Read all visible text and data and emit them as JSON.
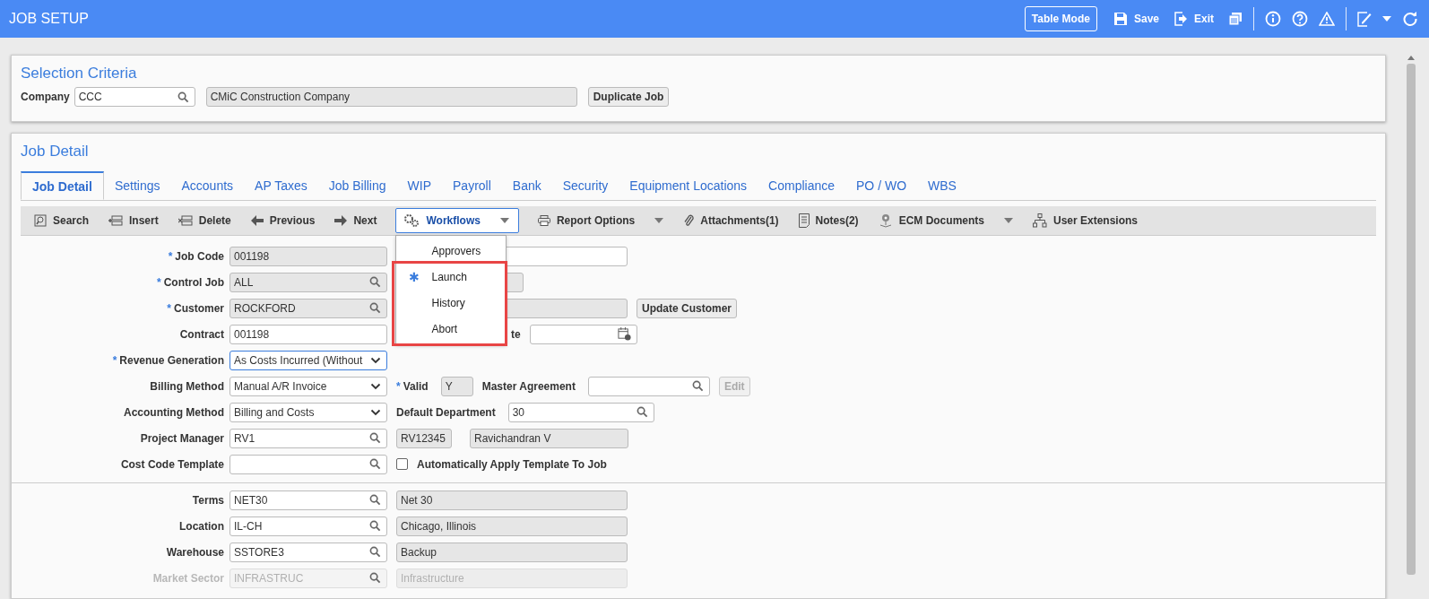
{
  "header": {
    "title": "JOB SETUP",
    "table_mode": "Table Mode",
    "save": "Save",
    "exit": "Exit"
  },
  "selection": {
    "title": "Selection Criteria",
    "company_label": "Company",
    "company": "CCC",
    "company_name": "CMiC Construction Company",
    "duplicate": "Duplicate Job"
  },
  "detail": {
    "title": "Job Detail",
    "tabs": [
      {
        "label": "Job Detail",
        "selected": true
      },
      {
        "label": "Settings",
        "selected": false
      },
      {
        "label": "Accounts",
        "selected": false
      },
      {
        "label": "AP Taxes",
        "selected": false
      },
      {
        "label": "Job Billing",
        "selected": false
      },
      {
        "label": "WIP",
        "selected": false
      },
      {
        "label": "Payroll",
        "selected": false
      },
      {
        "label": "Bank",
        "selected": false
      },
      {
        "label": "Security",
        "selected": false
      },
      {
        "label": "Equipment Locations",
        "selected": false
      },
      {
        "label": "Compliance",
        "selected": false
      },
      {
        "label": "PO / WO",
        "selected": false
      },
      {
        "label": "WBS",
        "selected": false
      }
    ],
    "toolbar": [
      {
        "label": "Search",
        "dropdown": false,
        "open": false
      },
      {
        "label": "Insert",
        "dropdown": false,
        "open": false
      },
      {
        "label": "Delete",
        "dropdown": false,
        "open": false
      },
      {
        "label": "Previous",
        "dropdown": false,
        "open": false
      },
      {
        "label": "Next",
        "dropdown": false,
        "open": false
      },
      {
        "label": "Workflows",
        "dropdown": true,
        "open": true
      },
      {
        "label": "Report Options",
        "dropdown": true,
        "open": false
      },
      {
        "label": "Attachments(1)",
        "dropdown": false,
        "open": false
      },
      {
        "label": "Notes(2)",
        "dropdown": false,
        "open": false
      },
      {
        "label": "ECM Documents",
        "dropdown": true,
        "open": false
      },
      {
        "label": "User Extensions",
        "dropdown": false,
        "open": false
      }
    ],
    "menu": [
      {
        "label": "Approvers"
      },
      {
        "label": "Launch",
        "icon": "✱"
      },
      {
        "label": "History"
      },
      {
        "label": "Abort"
      }
    ],
    "rows": [
      {
        "label": "Job Code",
        "mark": "*",
        "disabled": false,
        "field": {
          "kind": "text",
          "value": "001198",
          "readonly": true,
          "focused": false
        },
        "extras": [
          {
            "kind": "field",
            "readonly": false
          }
        ]
      },
      {
        "label": "Control Job",
        "mark": "*",
        "disabled": false,
        "field": {
          "kind": "lookup",
          "value": "ALL",
          "readonly": true,
          "focused": false
        },
        "extras": [
          {
            "kind": "field",
            "readonly": true
          }
        ]
      },
      {
        "label": "Customer",
        "mark": "*",
        "disabled": false,
        "field": {
          "kind": "lookup",
          "value": "ROCKFORD",
          "readonly": true,
          "focused": false
        },
        "extras": [
          {
            "kind": "field",
            "readonly": true
          },
          {
            "kind": "button",
            "label": "Update Customer",
            "disabled": false
          }
        ]
      },
      {
        "label": "Contract",
        "disabled": false,
        "field": {
          "kind": "text",
          "value": "001198",
          "readonly": false,
          "focused": false
        },
        "extras": [
          {
            "kind": "label",
            "label": "te"
          },
          {
            "kind": "date"
          }
        ]
      },
      {
        "label": "Revenue Generation",
        "mark": "*",
        "disabled": false,
        "field": {
          "kind": "select",
          "value": "As Costs Incurred (Without",
          "readonly": false,
          "focused": true
        },
        "extras": []
      },
      {
        "label": "Billing Method",
        "disabled": false,
        "field": {
          "kind": "select",
          "value": "Manual A/R Invoice",
          "readonly": false,
          "focused": false
        },
        "extras": [
          {
            "kind": "label",
            "label": "Valid",
            "mark": "*"
          },
          {
            "kind": "field",
            "value": "Y",
            "readonly": true
          },
          {
            "kind": "label",
            "label": "Master Agreement"
          },
          {
            "kind": "lookup",
            "readonly": false
          },
          {
            "kind": "button",
            "label": "Edit",
            "disabled": true
          }
        ]
      },
      {
        "label": "Accounting Method",
        "disabled": false,
        "field": {
          "kind": "select",
          "value": "Billing and Costs",
          "readonly": false,
          "focused": false
        },
        "extras": [
          {
            "kind": "label",
            "label": "Default Department"
          },
          {
            "kind": "lookup",
            "value": "30",
            "readonly": false
          }
        ]
      },
      {
        "label": "Project Manager",
        "disabled": false,
        "field": {
          "kind": "lookup",
          "value": "RV1",
          "readonly": false,
          "focused": false
        },
        "extras": [
          {
            "kind": "field",
            "value": "RV12345",
            "readonly": true
          },
          {
            "kind": "field",
            "value": "Ravichandran V",
            "readonly": true
          }
        ]
      },
      {
        "label": "Cost Code Template",
        "disabled": false,
        "field": {
          "kind": "lookup",
          "readonly": false,
          "focused": false
        },
        "extras": [
          {
            "kind": "checkbox",
            "label": "Automatically Apply Template To Job",
            "checked": false
          }
        ]
      },
      {
        "label": "Terms",
        "disabled": false,
        "divider": true,
        "field": {
          "kind": "lookup",
          "value": "NET30",
          "readonly": false,
          "focused": false
        },
        "extras": [
          {
            "kind": "field",
            "value": "Net 30",
            "readonly": true
          }
        ]
      },
      {
        "label": "Location",
        "disabled": false,
        "field": {
          "kind": "lookup",
          "value": "IL-CH",
          "readonly": false,
          "focused": false
        },
        "extras": [
          {
            "kind": "field",
            "value": "Chicago, Illinois",
            "readonly": true
          }
        ]
      },
      {
        "label": "Warehouse",
        "disabled": false,
        "field": {
          "kind": "lookup",
          "value": "SSTORE3",
          "readonly": false,
          "focused": false
        },
        "extras": [
          {
            "kind": "field",
            "value": "Backup",
            "readonly": true
          }
        ]
      },
      {
        "label": "Market Sector",
        "disabled": true,
        "field": {
          "kind": "lookup",
          "value": "INFRASTRUC",
          "readonly": false,
          "focused": false
        },
        "extras": [
          {
            "kind": "field",
            "value": "Infrastructure",
            "readonly": true
          }
        ]
      }
    ]
  }
}
